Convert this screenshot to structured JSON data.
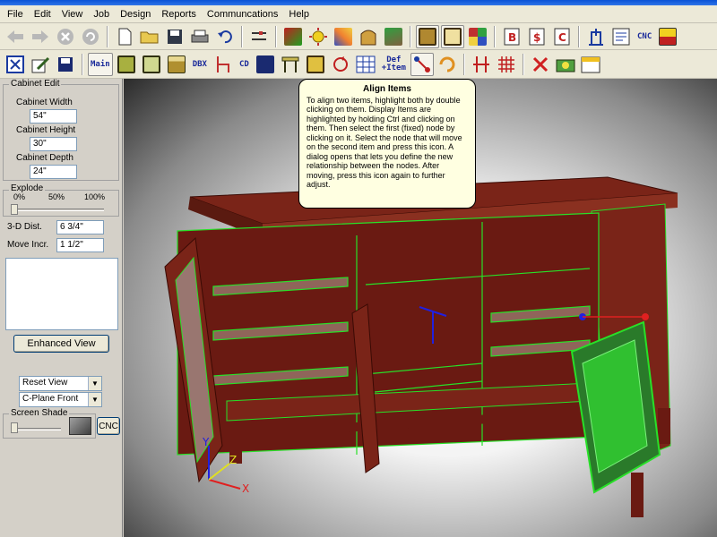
{
  "menu": [
    "File",
    "Edit",
    "View",
    "Job",
    "Design",
    "Reports",
    "Communcations",
    "Help"
  ],
  "toolbar1": {
    "left_icons": [
      "back-arrow-icon",
      "forward-arrow-icon",
      "stop-icon",
      "refresh-icon"
    ],
    "cnc_label": "CNC"
  },
  "toolbar2": {
    "main_label": "Main",
    "dbx_label": "DBX",
    "cd_label": "CD",
    "def_label": "Def",
    "item_label": "+Item"
  },
  "sidebar": {
    "cabinet_edit_title": "Cabinet Edit",
    "width_label": "Cabinet Width",
    "width_value": "54\"",
    "height_label": "Cabinet Height",
    "height_value": "30\"",
    "depth_label": "Cabinet Depth",
    "depth_value": "24\"",
    "explode_title": "Explode",
    "explode_ticks": [
      "0%",
      "50%",
      "100%"
    ],
    "explode_percent": 0,
    "dist_label": "3-D Dist.",
    "dist_value": "6 3/4\"",
    "move_label": "Move Incr.",
    "move_value": "1 1/2\"",
    "enhanced_view_label": "Enhanced View",
    "reset_view_value": "Reset View",
    "cplane_value": "C-Plane Front",
    "screen_shade_title": "Screen Shade",
    "cnc_label": "CNC"
  },
  "tooltip": {
    "title": "Align Items",
    "body": "To align two items, highlight both by double clicking on them. Display Items are highlighted by holding Ctrl and clicking on them. Then select the first (fixed) node by clicking on it. Select the node that will move on the second item and press this icon. A dialog opens that lets you define the new relationship between the nodes. After moving, press this icon again to further adjust."
  },
  "viewport": {
    "axis_x_label": "X",
    "axis_z_label": "Z",
    "axis_y_label": "Y"
  },
  "colors": {
    "wood": "#7a2418",
    "wood_light": "#9a3a28",
    "wireframe": "#28e028",
    "glass": "#c8d8c8",
    "axis_x": "#e02020",
    "axis_y": "#2020e0",
    "axis_z": "#e0e020"
  }
}
